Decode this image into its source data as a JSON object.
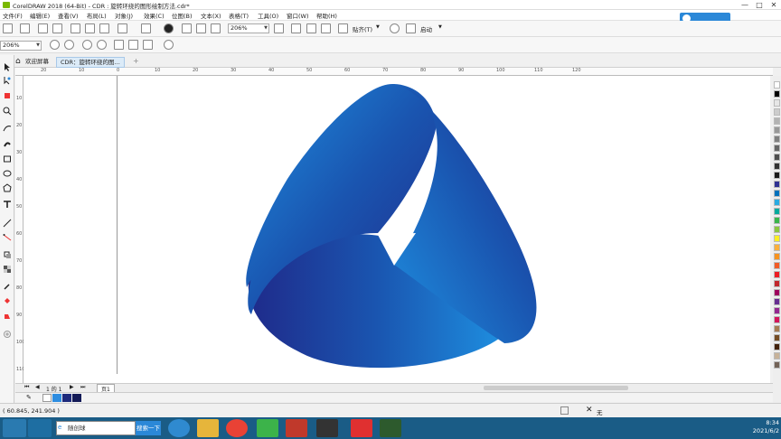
{
  "window": {
    "title": "CorelDRAW 2018 (64-Bit) - CDR : 旋转环绕的图形绘制方法.cdr*",
    "controls": [
      "—",
      "□",
      "✕"
    ]
  },
  "menu": [
    "文件(F)",
    "编辑(E)",
    "查看(V)",
    "布局(L)",
    "对象(J)",
    "效果(C)",
    "位图(B)",
    "文本(X)",
    "表格(T)",
    "工具(O)",
    "窗口(W)",
    "帮助(H)"
  ],
  "cloud_badge": "",
  "toolbar": {
    "zoom_value": "206%",
    "snap_label": "贴齐(T)",
    "launch_label": "启动"
  },
  "property_bar": {
    "zoom_value": "206%"
  },
  "tabs": {
    "welcome": "欢迎屏幕",
    "document": "CDR：旋转环绕的图..."
  },
  "rulers": {
    "h_ticks": [
      "20",
      "10",
      "0",
      "10",
      "20",
      "30",
      "40",
      "50",
      "60",
      "70",
      "80",
      "90",
      "100",
      "110",
      "120"
    ],
    "v_ticks": [
      "10",
      "20",
      "30",
      "40",
      "50",
      "60",
      "70",
      "80",
      "90",
      "100",
      "110"
    ]
  },
  "page_nav": {
    "page_of": "1 的 1",
    "page_tab": "页1"
  },
  "status": {
    "coordinates": "( 60.845, 241.904 )",
    "fill_none": "无"
  },
  "taskbar": {
    "search_placeholder": "随创球",
    "search_button": "搜索一下",
    "time": "8:34",
    "date": "2021/6/2"
  },
  "colors": {
    "shape_dark": "#1f2a8a",
    "shape_mid": "#1a55b0",
    "shape_light": "#1e8fe0",
    "taskbar": "#1a5c86",
    "accent": "#2b88d8"
  },
  "palette_colors": [
    "#ffffff",
    "#000000",
    "#e6e6e6",
    "#cccccc",
    "#b3b3b3",
    "#999999",
    "#808080",
    "#666666",
    "#4d4d4d",
    "#333333",
    "#1a1a1a",
    "#2e3192",
    "#0071bc",
    "#29abe2",
    "#00a99d",
    "#39b54a",
    "#8cc63f",
    "#fcee21",
    "#fbb03b",
    "#f7931e",
    "#f15a24",
    "#ed1c24",
    "#c1272d",
    "#9e005d",
    "#662d91",
    "#93278f",
    "#d4145a",
    "#a67c52",
    "#754c24",
    "#42210b",
    "#c7b299",
    "#736357"
  ],
  "doc_palette_colors": [
    "#2e8de0",
    "#1d2a7c",
    "#131a57"
  ]
}
